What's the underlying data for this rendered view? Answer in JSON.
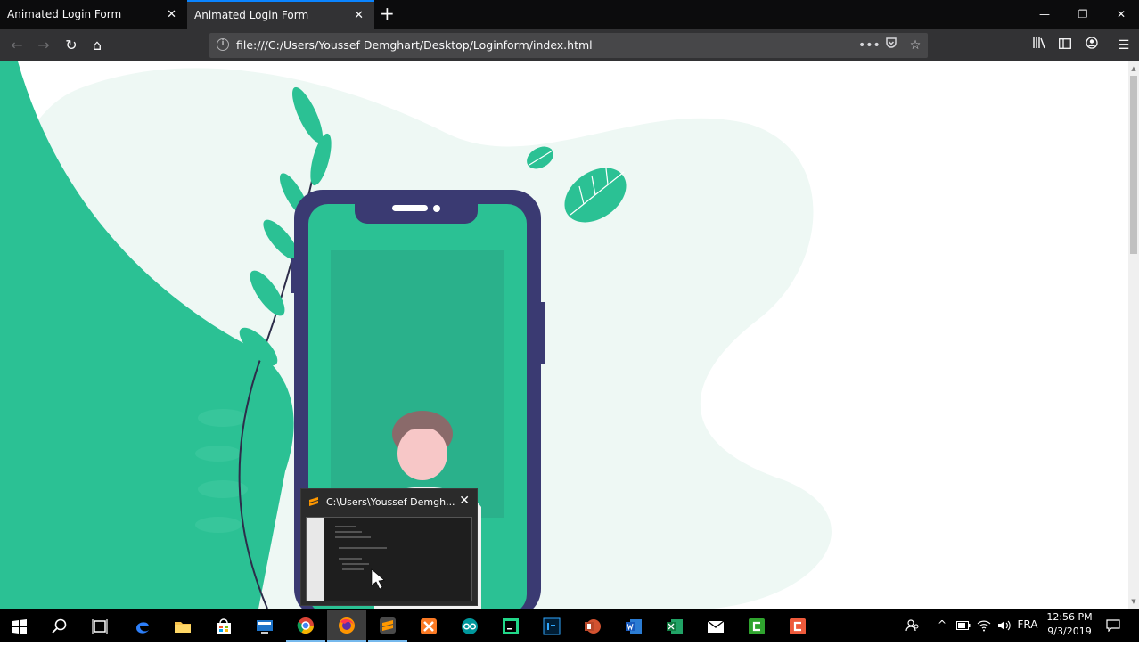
{
  "browser": {
    "tabs": [
      {
        "label": "Animated Login Form",
        "active": false
      },
      {
        "label": "Animated Login Form",
        "active": true
      }
    ],
    "new_tab_symbol": "+",
    "url": "file:///C:/Users/Youssef Demghart/Desktop/Loginform/index.html",
    "accent": "#0a84ff"
  },
  "page": {
    "primary_color": "#2bc194",
    "phone_color": "#3a3a72",
    "blob_color": "#eef8f4"
  },
  "taskbar": {
    "apps": [
      {
        "name": "start-icon"
      },
      {
        "name": "search-icon"
      },
      {
        "name": "task-view-icon"
      },
      {
        "name": "edge-icon"
      },
      {
        "name": "file-explorer-icon"
      },
      {
        "name": "store-icon"
      },
      {
        "name": "monitor-app-icon"
      },
      {
        "name": "chrome-icon"
      },
      {
        "name": "firefox-icon"
      },
      {
        "name": "sublime-text-icon"
      },
      {
        "name": "xampp-icon"
      },
      {
        "name": "arduino-icon"
      },
      {
        "name": "pycharm-icon"
      },
      {
        "name": "photoshop-icon"
      },
      {
        "name": "powerpoint-icon"
      },
      {
        "name": "word-icon"
      },
      {
        "name": "excel-icon"
      },
      {
        "name": "mail-icon"
      },
      {
        "name": "camtasia-icon"
      },
      {
        "name": "camtasia-recorder-icon"
      }
    ],
    "language": "FRA",
    "time": "12:56 PM",
    "date": "9/3/2019"
  },
  "preview": {
    "title": "C:\\Users\\Youssef Demgh..."
  }
}
